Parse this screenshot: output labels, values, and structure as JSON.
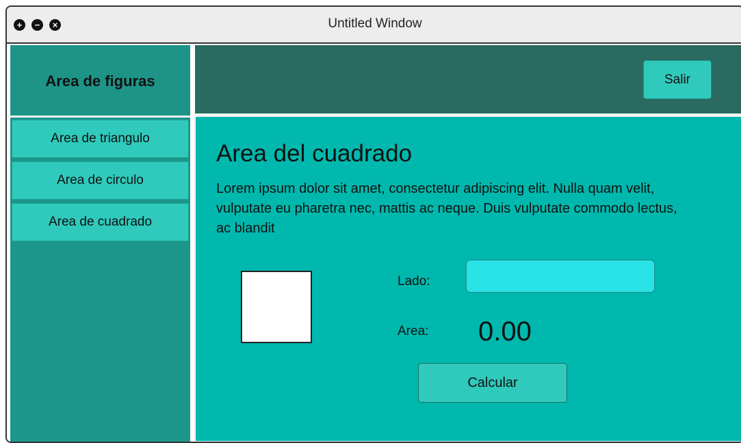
{
  "window": {
    "title": "Untitled Window",
    "controls": [
      {
        "icon": "plus-icon",
        "glyph": "+"
      },
      {
        "icon": "minus-icon",
        "glyph": "−"
      },
      {
        "icon": "close-icon",
        "glyph": "×"
      }
    ]
  },
  "sidebar": {
    "header": "Area de figuras",
    "items": [
      {
        "label": "Area de triangulo"
      },
      {
        "label": "Area de circulo"
      },
      {
        "label": "Area de cuadrado"
      }
    ]
  },
  "topbar": {
    "exit_label": "Salir"
  },
  "main": {
    "title": "Area del cuadrado",
    "description": "Lorem ipsum dolor sit amet, consectetur adipiscing elit. Nulla quam velit, vulputate eu pharetra nec, mattis ac neque. Duis vulputate commodo lectus, ac blandit",
    "side_label": "Lado:",
    "side_value": "",
    "area_label": "Area:",
    "area_value": "0.00",
    "calculate_label": "Calcular"
  },
  "colors": {
    "sidebar": "#1c968a",
    "topbar": "#2a6a60",
    "main": "#00b8ad",
    "button": "#2fcabc",
    "input": "#2ae3e6"
  }
}
